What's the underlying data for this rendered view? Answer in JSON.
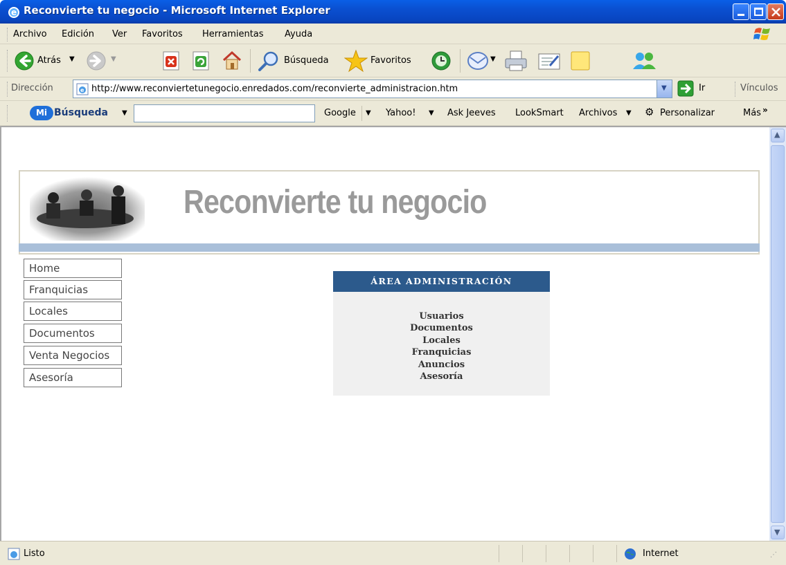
{
  "window": {
    "title": "Reconvierte tu negocio - Microsoft Internet Explorer"
  },
  "menu": [
    "Archivo",
    "Edición",
    "Ver",
    "Favoritos",
    "Herramientas",
    "Ayuda"
  ],
  "toolbar": {
    "back": "Atrás",
    "search": "Búsqueda",
    "favorites": "Favoritos"
  },
  "address": {
    "label": "Dirección",
    "url": "http://www.reconviertetunegocio.enredados.com/reconvierte_administracion.htm",
    "go": "Ir",
    "links": "Vínculos"
  },
  "search_toolbar": {
    "logo": "Mi",
    "brand": "Búsqueda",
    "search_placeholder": "",
    "items": [
      "Google",
      "Yahoo!",
      "Ask Jeeves",
      "LookSmart",
      "Archivos",
      "Personalizar",
      "Más"
    ]
  },
  "site": {
    "title": "Reconvierte tu negocio"
  },
  "nav": [
    "Home",
    "Franquicias",
    "Locales",
    "Documentos",
    "Venta Negocios",
    "Asesoría"
  ],
  "admin": {
    "heading": "ÁREA ADMINISTRACIÓN",
    "links": [
      "Usuarios",
      "Documentos",
      "Locales",
      "Franquicias",
      "Anuncios",
      "Asesoría"
    ]
  },
  "status": {
    "text": "Listo",
    "zone": "Internet"
  }
}
